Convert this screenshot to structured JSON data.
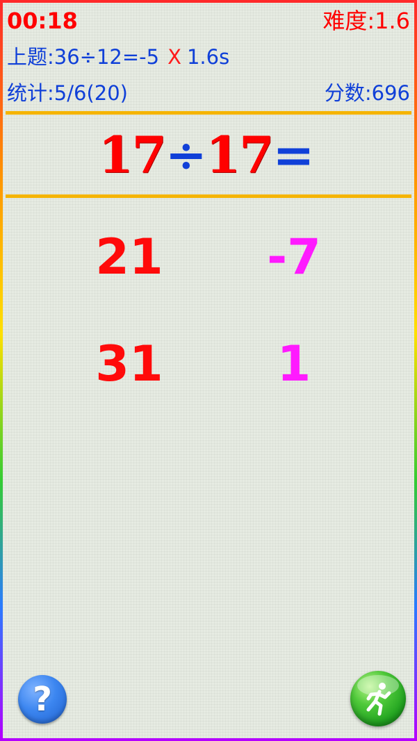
{
  "hud": {
    "timer": "00:18",
    "difficulty": "难度:1.6",
    "last_question": {
      "prefix": "上题:",
      "expression": "36÷12=-5",
      "result_mark": "X",
      "time": "1.6s"
    },
    "stats": "统计:5/6(20)",
    "score": "分数:696"
  },
  "question": {
    "left_operand": "17",
    "operator": "÷",
    "right_operand": "17",
    "equals": "="
  },
  "answers": [
    {
      "value": "21",
      "color": "#ff0a0a"
    },
    {
      "value": "-7",
      "color": "#ff1aff"
    },
    {
      "value": "31",
      "color": "#ff0a0a"
    },
    {
      "value": "1",
      "color": "#ff1aff"
    }
  ],
  "buttons": {
    "help_glyph": "?",
    "help_icon": "question-mark-icon",
    "exit_icon": "running-man-icon"
  },
  "colors": {
    "timer": "#ff0000",
    "hud_blue": "#1040d8",
    "divider": "#f5b400",
    "help_blue": "#3c86f0",
    "exit_green": "#21a320"
  }
}
